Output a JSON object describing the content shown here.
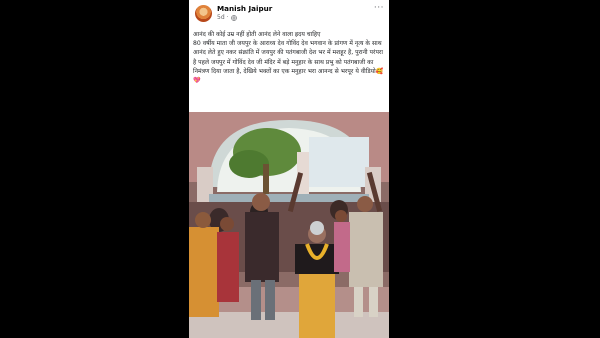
{
  "post": {
    "author": "Manish Jaipur",
    "time": "5d",
    "separator": "·",
    "privacy_icon": "globe-icon",
    "more_icon": "more-options-icon",
    "more_label": "···",
    "caption": "आनंद की कोई उम्र नहीं होती आनंद लेने वाला ह्रदय चाहिए\n80 वर्षीय माता जी जयपुर के आराध्य देव गोविंद देव भगवान के प्रांगण में नृत्य के साथ आनंद लेते हुए          नकर संक्रांति में जयपुर की पतंगबाजी देश भर में मशहूर है, पुरानी परंपरा है पहले जयपुर में गोविंद देव जी मंदिर में बड़े मनुहार के साथ प्रभु को पतंगबाजी का निमंत्रण दिया जाता है, देखिये भक्तों का एक मनुहार भरा आनन्द से भरपूर ये वीडियो🥰💖",
    "media_description_icon": "video-frame"
  }
}
